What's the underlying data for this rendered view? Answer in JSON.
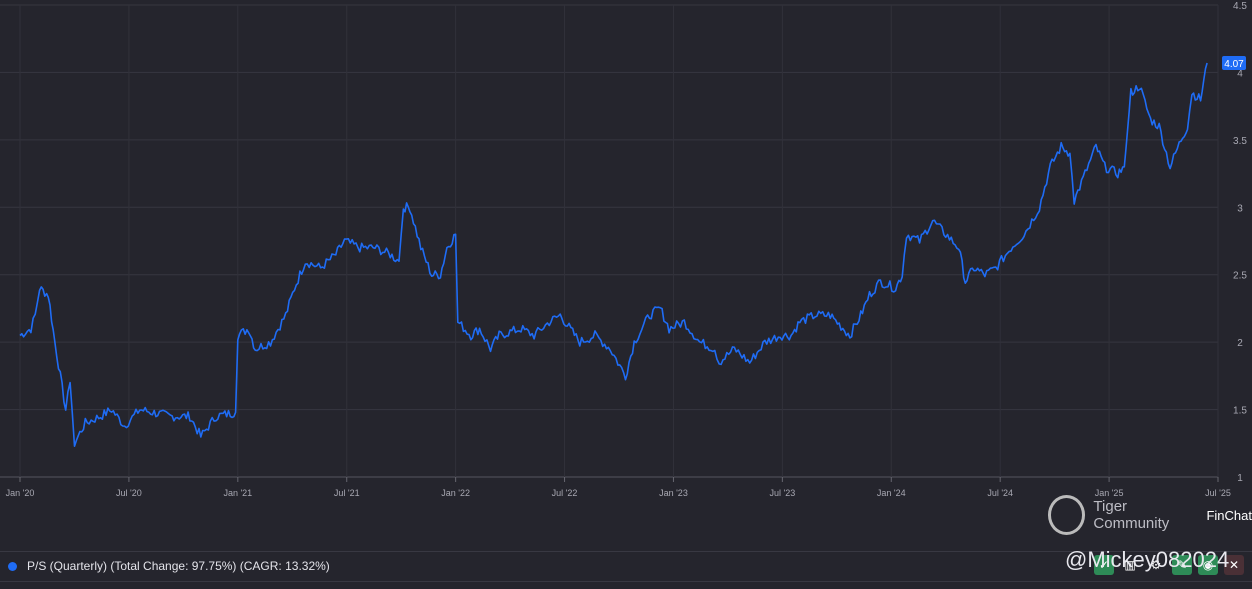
{
  "chart_data": {
    "type": "line",
    "title": "",
    "xlabel": "",
    "ylabel": "",
    "x_unit": "years since Jan 2020",
    "x_ticks": [
      "Jan '20",
      "Jul '20",
      "Jan '21",
      "Jul '21",
      "Jan '22",
      "Jul '22",
      "Jan '23",
      "Jul '23",
      "Jan '24",
      "Jul '24",
      "Jan '25",
      "Jul '25"
    ],
    "y_ticks": [
      "1",
      "1.5",
      "2",
      "2.5",
      "3",
      "3.5",
      "4",
      "4.5"
    ],
    "ylim": [
      1,
      4.5
    ],
    "xlim": [
      0,
      5.5
    ],
    "grid": true,
    "legend_position": "bottom-left",
    "last_value_label": "4.07",
    "series": [
      {
        "name": "P/S (Quarterly) (Total Change: 97.75%) (CAGR: 13.32%)",
        "color": "#1f6cf5",
        "points": [
          [
            0,
            2.05
          ],
          [
            0.05,
            2.1
          ],
          [
            0.07,
            2.2
          ],
          [
            0.09,
            2.4
          ],
          [
            0.13,
            2.35
          ],
          [
            0.16,
            2.0
          ],
          [
            0.21,
            1.5
          ],
          [
            0.23,
            1.7
          ],
          [
            0.25,
            1.25
          ],
          [
            0.3,
            1.4
          ],
          [
            0.37,
            1.45
          ],
          [
            0.42,
            1.5
          ],
          [
            0.48,
            1.38
          ],
          [
            0.55,
            1.5
          ],
          [
            0.69,
            1.45
          ],
          [
            0.78,
            1.45
          ],
          [
            0.83,
            1.3
          ],
          [
            0.9,
            1.45
          ],
          [
            0.99,
            1.48
          ],
          [
            1.0,
            2.05
          ],
          [
            1.05,
            2.1
          ],
          [
            1.08,
            1.95
          ],
          [
            1.15,
            2.0
          ],
          [
            1.22,
            2.2
          ],
          [
            1.26,
            2.4
          ],
          [
            1.31,
            2.6
          ],
          [
            1.38,
            2.55
          ],
          [
            1.45,
            2.65
          ],
          [
            1.49,
            2.75
          ],
          [
            1.56,
            2.7
          ],
          [
            1.63,
            2.7
          ],
          [
            1.7,
            2.65
          ],
          [
            1.74,
            2.6
          ],
          [
            1.76,
            3.0
          ],
          [
            1.79,
            3.0
          ],
          [
            1.84,
            2.7
          ],
          [
            1.89,
            2.5
          ],
          [
            1.93,
            2.5
          ],
          [
            1.96,
            2.7
          ],
          [
            2.0,
            2.8
          ],
          [
            2.01,
            2.15
          ],
          [
            2.07,
            2.05
          ],
          [
            2.11,
            2.1
          ],
          [
            2.16,
            1.95
          ],
          [
            2.2,
            2.05
          ],
          [
            2.3,
            2.1
          ],
          [
            2.36,
            2.05
          ],
          [
            2.43,
            2.15
          ],
          [
            2.48,
            2.2
          ],
          [
            2.57,
            2.0
          ],
          [
            2.64,
            2.05
          ],
          [
            2.71,
            1.95
          ],
          [
            2.78,
            1.75
          ],
          [
            2.82,
            2.0
          ],
          [
            2.89,
            2.2
          ],
          [
            2.94,
            2.25
          ],
          [
            2.98,
            2.1
          ],
          [
            3.05,
            2.15
          ],
          [
            3.12,
            2.0
          ],
          [
            3.19,
            1.95
          ],
          [
            3.21,
            1.85
          ],
          [
            3.28,
            1.95
          ],
          [
            3.35,
            1.85
          ],
          [
            3.42,
            2.0
          ],
          [
            3.49,
            2.05
          ],
          [
            3.54,
            2.05
          ],
          [
            3.58,
            2.15
          ],
          [
            3.65,
            2.2
          ],
          [
            3.72,
            2.2
          ],
          [
            3.81,
            2.05
          ],
          [
            3.86,
            2.2
          ],
          [
            3.9,
            2.35
          ],
          [
            3.95,
            2.45
          ],
          [
            4.02,
            2.4
          ],
          [
            4.05,
            2.5
          ],
          [
            4.07,
            2.8
          ],
          [
            4.13,
            2.75
          ],
          [
            4.19,
            2.9
          ],
          [
            4.25,
            2.8
          ],
          [
            4.31,
            2.7
          ],
          [
            4.34,
            2.45
          ],
          [
            4.38,
            2.55
          ],
          [
            4.43,
            2.5
          ],
          [
            4.48,
            2.55
          ],
          [
            4.55,
            2.7
          ],
          [
            4.61,
            2.8
          ],
          [
            4.68,
            3.0
          ],
          [
            4.73,
            3.3
          ],
          [
            4.78,
            3.45
          ],
          [
            4.82,
            3.4
          ],
          [
            4.84,
            3.05
          ],
          [
            4.89,
            3.25
          ],
          [
            4.94,
            3.45
          ],
          [
            4.98,
            3.3
          ],
          [
            5.04,
            3.25
          ],
          [
            5.07,
            3.3
          ],
          [
            5.1,
            3.85
          ],
          [
            5.14,
            3.9
          ],
          [
            5.19,
            3.65
          ],
          [
            5.23,
            3.6
          ],
          [
            5.28,
            3.3
          ],
          [
            5.33,
            3.5
          ],
          [
            5.36,
            3.6
          ],
          [
            5.38,
            3.85
          ],
          [
            5.42,
            3.8
          ],
          [
            5.45,
            4.07
          ]
        ]
      }
    ]
  },
  "legend": {
    "label": "P/S (Quarterly) (Total Change: 97.75%) (CAGR: 13.32%)"
  },
  "watermark": {
    "brand": "Tiger Community",
    "app": "FinChat",
    "handle": "@Mickey082024"
  }
}
